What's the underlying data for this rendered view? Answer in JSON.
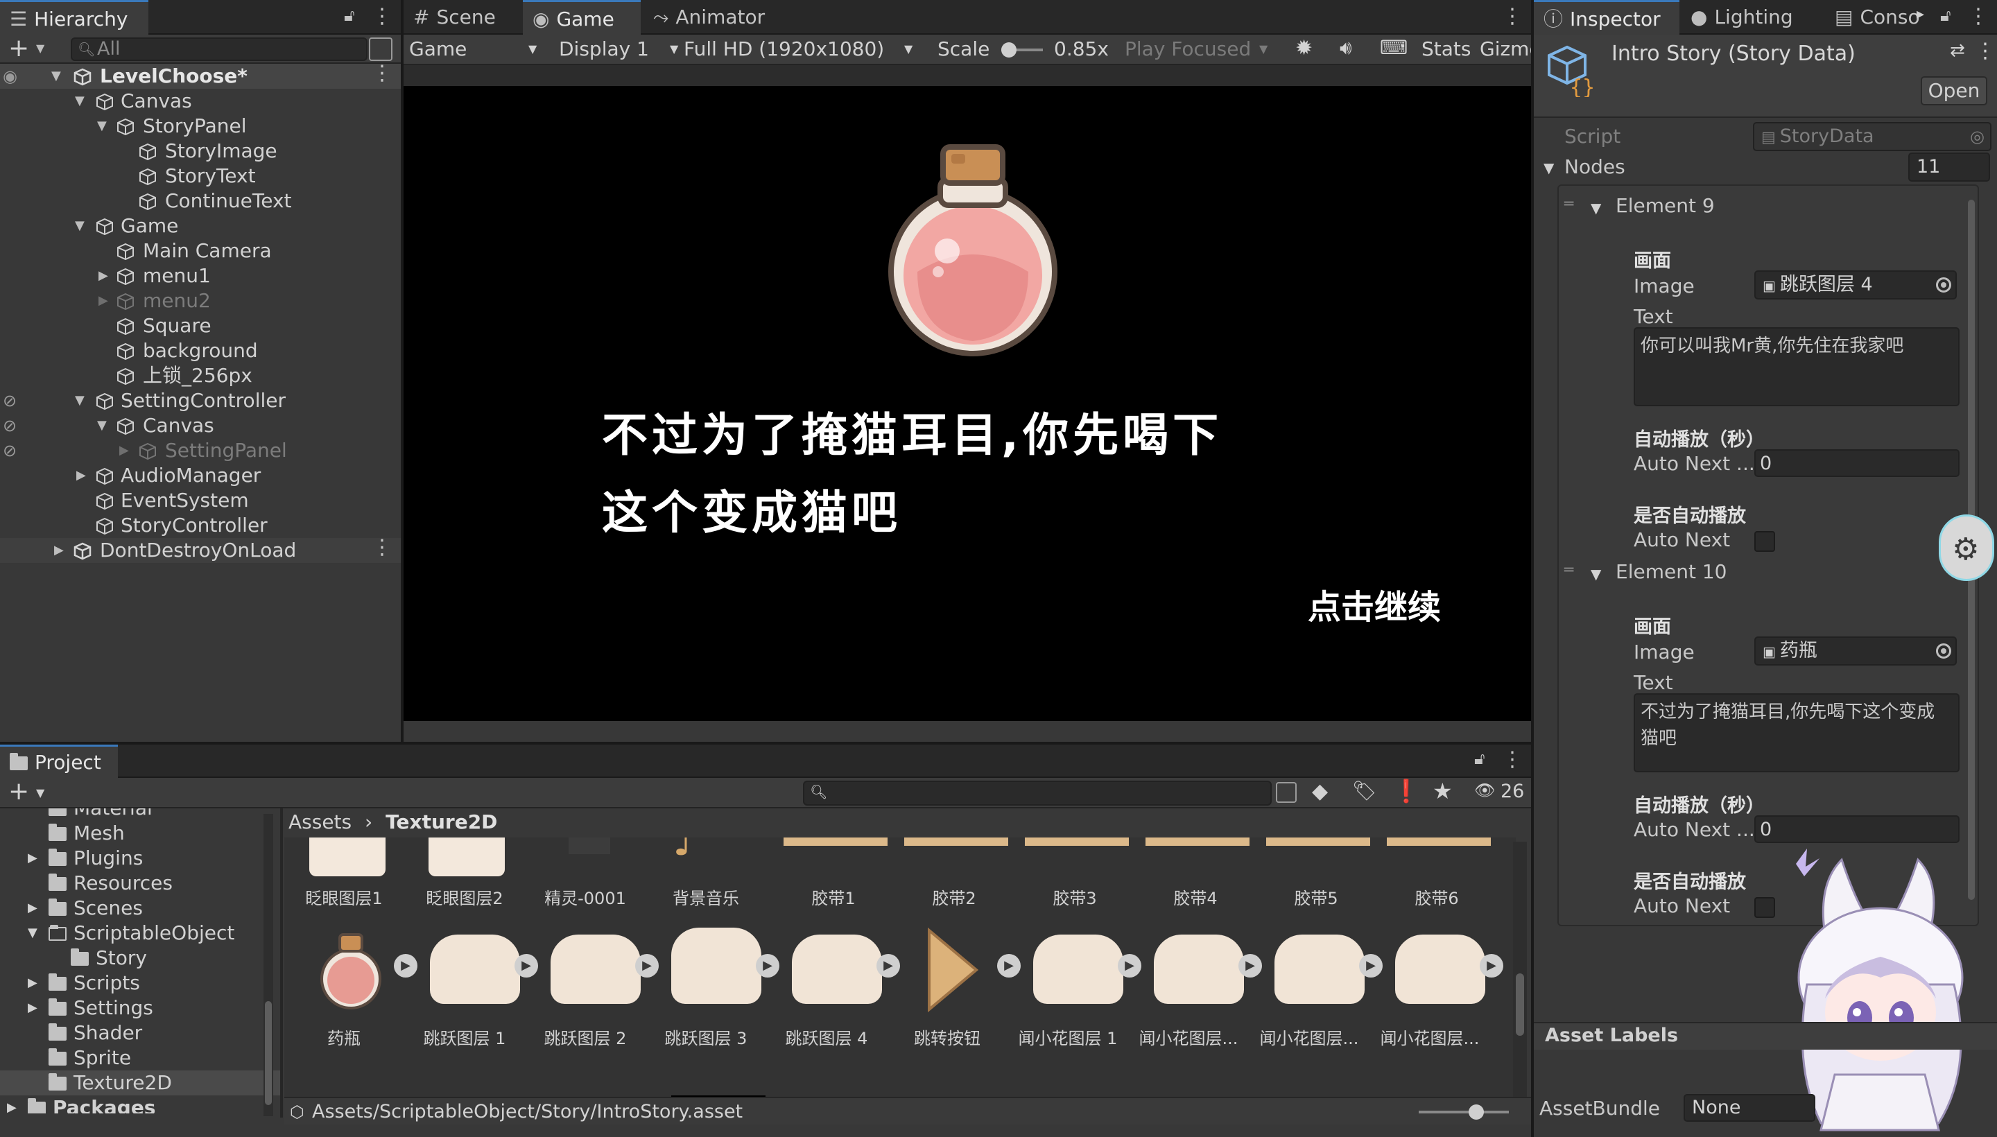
{
  "hierarchy": {
    "tab_label": "Hierarchy",
    "search_placeholder": "All",
    "rows": [
      {
        "label": "LevelChoose*"
      },
      {
        "label": "Canvas"
      },
      {
        "label": "StoryPanel"
      },
      {
        "label": "StoryImage"
      },
      {
        "label": "StoryText"
      },
      {
        "label": "ContinueText"
      },
      {
        "label": "Game"
      },
      {
        "label": "Main Camera"
      },
      {
        "label": "menu1"
      },
      {
        "label": "menu2"
      },
      {
        "label": "Square"
      },
      {
        "label": "background"
      },
      {
        "label": "上锁_256px"
      },
      {
        "label": "SettingController"
      },
      {
        "label": "Canvas"
      },
      {
        "label": "SettingPanel"
      },
      {
        "label": "AudioManager"
      },
      {
        "label": "EventSystem"
      },
      {
        "label": "StoryController"
      },
      {
        "label": "DontDestroyOnLoad"
      }
    ]
  },
  "game_view": {
    "tabs": [
      {
        "label": "Scene",
        "icon": "grid-icon"
      },
      {
        "label": "Game",
        "icon": "gamepad-icon"
      },
      {
        "label": "Animator",
        "icon": "animator-icon"
      }
    ],
    "toolbar": {
      "mode": "Game",
      "display": "Display 1",
      "resolution": "Full HD (1920x1080)",
      "scale_label": "Scale",
      "scale_value": "0.85x",
      "play_mode": "Play Focused",
      "stats": "Stats",
      "gizmos": "Gizmo"
    },
    "story_line1": "不过为了掩猫耳目,你先喝下",
    "story_line2": "这个变成猫吧",
    "continue_text": "点击继续"
  },
  "inspector": {
    "tabs": [
      {
        "label": "Inspector"
      },
      {
        "label": "Lighting"
      },
      {
        "label": "Conso"
      }
    ],
    "asset_title": "Intro Story (Story Data)",
    "open_button": "Open",
    "script_label": "Script",
    "script_value": "StoryData",
    "nodes_label": "Nodes",
    "nodes_count": "11",
    "elements": [
      {
        "name": "Element 9",
        "section_image": "画面",
        "image_label": "Image",
        "image_value": "跳跃图层 4",
        "text_label": "Text",
        "text_value": "你可以叫我Mr黄,你先住在我家吧",
        "auto_seconds_header": "自动播放（秒）",
        "auto_next_seconds_label": "Auto Next ...",
        "auto_next_seconds_value": "0",
        "auto_header": "是否自动播放",
        "auto_next_label": "Auto Next"
      },
      {
        "name": "Element 10",
        "section_image": "画面",
        "image_label": "Image",
        "image_value": "药瓶",
        "text_label": "Text",
        "text_value": "不过为了掩猫耳目,你先喝下这个变成猫吧",
        "auto_seconds_header": "自动播放（秒）",
        "auto_next_seconds_label": "Auto Next ...",
        "auto_next_seconds_value": "0",
        "auto_header": "是否自动播放",
        "auto_next_label": "Auto Next"
      }
    ],
    "asset_labels": "Asset Labels",
    "assetbundle_label": "AssetBundle",
    "assetbundle_value": "None"
  },
  "project": {
    "tab_label": "Project",
    "count": "26",
    "breadcrumb": [
      "Assets",
      "Texture2D"
    ],
    "folders": [
      {
        "label": "Material"
      },
      {
        "label": "Mesh"
      },
      {
        "label": "Plugins"
      },
      {
        "label": "Resources"
      },
      {
        "label": "Scenes"
      },
      {
        "label": "ScriptableObject"
      },
      {
        "label": "Story"
      },
      {
        "label": "Scripts"
      },
      {
        "label": "Settings"
      },
      {
        "label": "Shader"
      },
      {
        "label": "Sprite"
      },
      {
        "label": "Texture2D"
      },
      {
        "label": "Packages"
      }
    ],
    "row1_labels": [
      "眨眼图层1",
      "眨眼图层2",
      "精灵-0001",
      "背景音乐",
      "胶带1",
      "胶带2",
      "胶带3",
      "胶带4",
      "胶带5",
      "胶带6"
    ],
    "row2_labels": [
      "药瓶",
      "跳跃图层 1",
      "跳跃图层 2",
      "跳跃图层 3",
      "跳跃图层 4",
      "跳转按钮",
      "闻小花图层 1",
      "闻小花图层...",
      "闻小花图层...",
      "闻小花图层..."
    ],
    "status_path": "Assets/ScriptableObject/Story/IntroStory.asset"
  },
  "colors": {
    "accent": "#3a79bb",
    "panel": "#383838",
    "game_bg": "#000000"
  }
}
